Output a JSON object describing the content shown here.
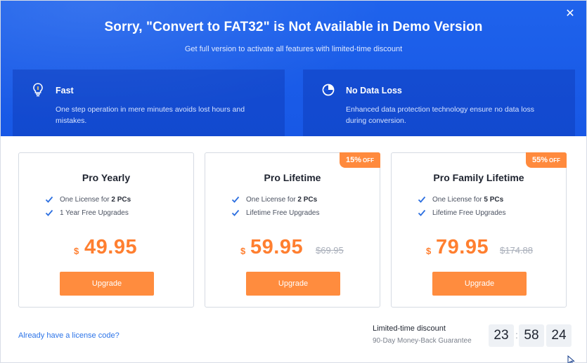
{
  "header": {
    "title": "Sorry, \"Convert to FAT32\" is Not Available in Demo Version",
    "subtitle": "Get full version to activate all features with limited-time discount",
    "close_label": "✕"
  },
  "features": [
    {
      "icon": "lightbulb-icon",
      "title": "Fast",
      "description": "One step operation in mere minutes avoids lost hours and mistakes."
    },
    {
      "icon": "shield-pie-icon",
      "title": "No Data Loss",
      "description": "Enhanced data protection technology ensure no data loss during conversion."
    }
  ],
  "plans": [
    {
      "name": "Pro Yearly",
      "badge": "",
      "features": [
        {
          "text": "One License for ",
          "bold": "2 PCs"
        },
        {
          "text": "1 Year Free Upgrades",
          "bold": ""
        }
      ],
      "currency": "$",
      "price": "49.95",
      "old_price": "",
      "button": "Upgrade"
    },
    {
      "name": "Pro Lifetime",
      "badge": "15%",
      "badge_suffix": "OFF",
      "features": [
        {
          "text": "One License for ",
          "bold": "2 PCs"
        },
        {
          "text": "Lifetime Free Upgrades",
          "bold": ""
        }
      ],
      "currency": "$",
      "price": "59.95",
      "old_price": "$69.95",
      "button": "Upgrade"
    },
    {
      "name": "Pro Family Lifetime",
      "badge": "55%",
      "badge_suffix": "OFF",
      "features": [
        {
          "text": "One License for ",
          "bold": "5 PCs"
        },
        {
          "text": "Lifetime Free Upgrades",
          "bold": ""
        }
      ],
      "currency": "$",
      "price": "79.95",
      "old_price": "$174.88",
      "button": "Upgrade"
    }
  ],
  "footer": {
    "license_link": "Already have a license code?",
    "discount_label": "Limited-time discount",
    "guarantee": "90-Day Money-Back Guarantee",
    "timer": {
      "hours": "23",
      "minutes": "58",
      "seconds": "24",
      "separator": ":"
    }
  },
  "colors": {
    "header_blue": "#1a5ce8",
    "accent_orange": "#ff8c3e",
    "link_blue": "#2c74e8",
    "check_blue": "#2c6fe0"
  }
}
